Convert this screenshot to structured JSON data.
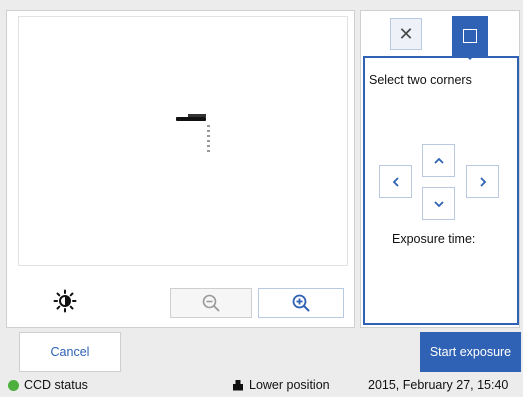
{
  "image_panel": {
    "icons": {
      "brightness": "brightness-icon",
      "zoom_out": "zoom-out-icon",
      "zoom_in": "zoom-in-icon"
    }
  },
  "tool_panel": {
    "icons": {
      "clear": "close-icon",
      "select": "square-select-icon"
    },
    "hint": "Select two corners",
    "arrows": [
      "chevron-up-icon",
      "chevron-down-icon",
      "chevron-left-icon",
      "chevron-right-icon"
    ],
    "exposure_label": "Exposure time:"
  },
  "actions": {
    "cancel_label": "Cancel",
    "start_label": "Start exposure"
  },
  "status_bar": {
    "ccd_label": "CCD status",
    "ccd_color": "#4caf3e",
    "position_label": "Lower position",
    "datetime": "2015, February 27, 15:40"
  },
  "colors": {
    "accent": "#2f62b4",
    "background": "#ececec"
  }
}
